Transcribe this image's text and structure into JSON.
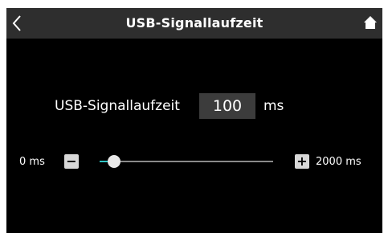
{
  "header": {
    "title": "USB-Signallaufzeit",
    "back_icon": "chevron-left-icon",
    "home_icon": "home-icon"
  },
  "setting": {
    "label": "USB-Signallaufzeit",
    "value": "100",
    "unit": "ms"
  },
  "slider": {
    "min_label": "0 ms",
    "max_label": "2000 ms",
    "minus_label": "−",
    "plus_label": "+",
    "min": 0,
    "max": 2000,
    "current": 100,
    "accent_color": "#2ec4c4"
  },
  "colors": {
    "screen_background": "#000000",
    "header_background": "#2e2e2e",
    "value_box_background": "#3c3c3c"
  }
}
